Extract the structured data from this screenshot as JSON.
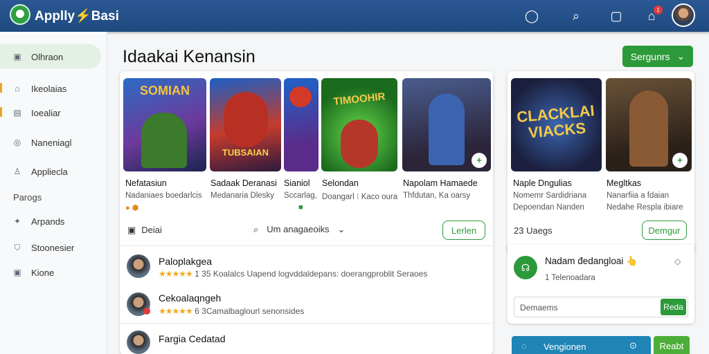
{
  "app": {
    "brand": "Applly⚡Basi"
  },
  "header": {
    "notification_count": "1"
  },
  "sidebar": {
    "items": [
      {
        "label": "Olhraon",
        "icon": "store-icon"
      },
      {
        "label": "Ikeolaias",
        "icon": "home-icon"
      },
      {
        "label": "Ioealiar",
        "icon": "list-icon"
      },
      {
        "label": "Naneniagl",
        "icon": "circle-icon"
      },
      {
        "label": "Appliecla",
        "icon": "thumb-icon"
      }
    ],
    "section": "Parogs",
    "sub_items": [
      {
        "label": "Arpands",
        "icon": "tag-icon"
      },
      {
        "label": "Stoonesier",
        "icon": "shield-icon"
      },
      {
        "label": "Kione",
        "icon": "box-icon"
      }
    ]
  },
  "main": {
    "title": "Idaakai Kenansin",
    "sort_button": "Sergunrs"
  },
  "apps": [
    {
      "title": "Nefatasiun",
      "sub": "Nadaniaes boedarlcis",
      "art_text": "SOMIAN"
    },
    {
      "title": "Sadaak Deranasi",
      "sub": "Medanaria Dlesky",
      "art_text": "TUBSAIAN"
    },
    {
      "title": "Sianiol",
      "sub": "Sccarlag,"
    },
    {
      "title": "Selondan",
      "sub": "Doangarl ⁝ Kaco oura",
      "art_text": "TIMOOHIR"
    },
    {
      "title": "Napolam Hamaede",
      "sub": "Thfdutan, Ka oarsy"
    },
    {
      "title": "Naple Dngulias",
      "sub": "Nomemr Sardidriana",
      "sub2": "Depoendan Nanden",
      "art_text": "CLACKLAI VIACKS"
    },
    {
      "title": "Megltkas",
      "sub": "Nanarfiia a fdaian",
      "sub2": "Nedahe Respla ibiare"
    }
  ],
  "toolbar": {
    "detail_label": "Deiai",
    "search_label": "Um anagaeoiks",
    "primary_action": "Lerlen",
    "side_count": "23 Uaegs",
    "side_action": "Demgur"
  },
  "reviews": [
    {
      "name": "Paloplakgea",
      "rating": "★★★★★",
      "meta": "1 35 Koalalcs Uapend logvddaldepans: doerangproblit Seraoes"
    },
    {
      "name": "Cekoalaqngeh",
      "rating": "★★★★★",
      "meta": "6 3Camalbaglourl senonsides"
    },
    {
      "name": "Fargia Cedatad"
    }
  ],
  "side_panel": {
    "notice_title": "Nadam đedangloai 👆",
    "notice_meta": "1 Telenoadara",
    "input_placeholder": "Demaems",
    "input_button": "Reda",
    "bottom_label": "Vengionen",
    "bottom_button": "Reabt"
  }
}
